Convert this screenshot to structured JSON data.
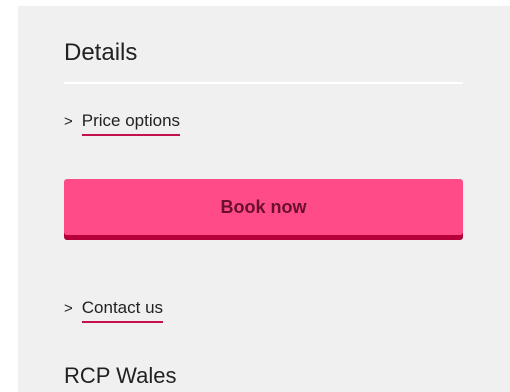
{
  "details": {
    "heading": "Details",
    "price_options": {
      "chevron": ">",
      "label": "Price options"
    },
    "book_button_label": "Book now",
    "contact_us": {
      "chevron": ">",
      "label": "Contact us"
    },
    "org_title": "RCP Wales"
  },
  "colors": {
    "panel_background": "#f0f0f0",
    "button_fill": "#ff4b88",
    "button_shadow": "#b5003c",
    "link_underline": "#c4104f"
  }
}
